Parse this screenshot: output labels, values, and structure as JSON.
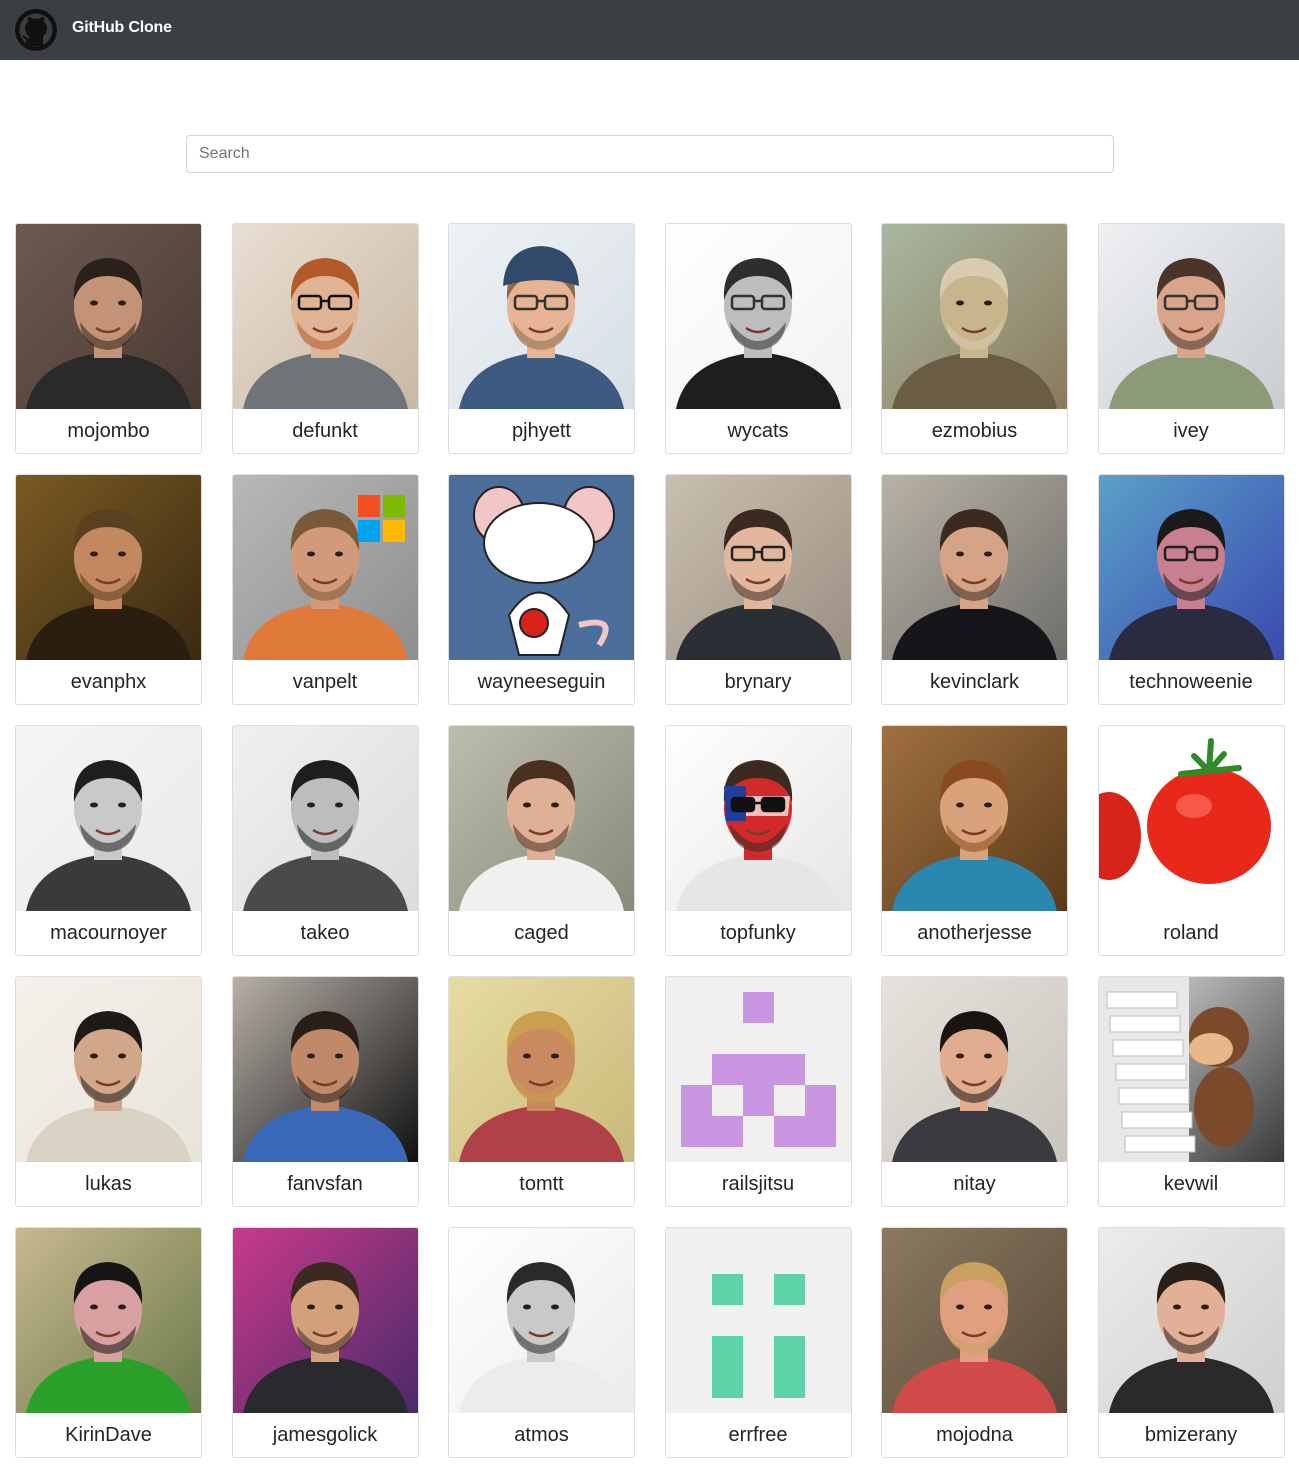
{
  "app": {
    "brand": "GitHub Clone",
    "logo_icon": "github-octocat-icon"
  },
  "search": {
    "placeholder": "Search",
    "value": ""
  },
  "users": [
    {
      "login": "mojombo",
      "bg": "#4a3a34",
      "skin": "#c49377",
      "hair": "#2b211c",
      "shirt": "#2a2a2a",
      "bgLight": "#6d5a50"
    },
    {
      "login": "defunkt",
      "bg": "#c9b8a4",
      "skin": "#e0b394",
      "hair": "#b35a2a",
      "shirt": "#6f7478",
      "bgLight": "#e8ded2",
      "glasses": "#111111"
    },
    {
      "login": "pjhyett",
      "bg": "#d7dfe5",
      "skin": "#e6b495",
      "hair": "#8a6a48",
      "shirt": "#3d5a80",
      "bgLight": "#eef2f5",
      "cap": "#2f4a6b",
      "glasses": "#333333"
    },
    {
      "login": "wycats",
      "bg": "#f2f2f2",
      "skin": "#bdbdbd",
      "hair": "#2e2e2e",
      "shirt": "#1e1e1e",
      "bgLight": "#ffffff",
      "glasses": "#333333"
    },
    {
      "login": "ezmobius",
      "bg": "#8a7a5e",
      "skin": "#c7b58c",
      "hair": "#d8cbb0",
      "shirt": "#6b5c45",
      "bgLight": "#a9b7a0"
    },
    {
      "login": "ivey",
      "bg": "#c9ccd1",
      "skin": "#d8a48a",
      "hair": "#4a3528",
      "shirt": "#8c9a7a",
      "bgLight": "#eef0f2",
      "glasses": "#333333"
    },
    {
      "login": "evanphx",
      "bg": "#3a2a12",
      "skin": "#c28860",
      "hair": "#5a4020",
      "shirt": "#2a1e10",
      "bgLight": "#7a5a22"
    },
    {
      "login": "vanpelt",
      "bg": "#8e8e8e",
      "skin": "#d29a78",
      "hair": "#7a5a38",
      "shirt": "#e07a3a",
      "bgLight": "#b8b8b8",
      "mslogo": true
    },
    {
      "login": "wayneeseguin",
      "bg": "#4c6e9a",
      "skin": "#ffffff",
      "hair": "#f2c6c6",
      "shirt": "#ffffff",
      "bgLight": "#4c6e9a",
      "cartoon": true
    },
    {
      "login": "brynary",
      "bg": "#9a8f82",
      "skin": "#e2b79e",
      "hair": "#3a2a20",
      "shirt": "#2a2e35",
      "bgLight": "#c9bfb0",
      "glasses": "#222222"
    },
    {
      "login": "kevinclark",
      "bg": "#6e6e6a",
      "skin": "#d5a386",
      "hair": "#3a2a20",
      "shirt": "#15151a",
      "bgLight": "#b9b2a6"
    },
    {
      "login": "technoweenie",
      "bg": "#3a4ab0",
      "skin": "#c87f8f",
      "hair": "#1a1a1a",
      "shirt": "#2a2a40",
      "bgLight": "#5aa0c8",
      "glasses": "#222222"
    },
    {
      "login": "macournoyer",
      "bg": "#eaeaea",
      "skin": "#c9c9c9",
      "hair": "#1f1f1f",
      "shirt": "#3a3a3a",
      "bgLight": "#f5f5f5"
    },
    {
      "login": "takeo",
      "bg": "#dcdcdc",
      "skin": "#bdbdbd",
      "hair": "#1e1e1e",
      "shirt": "#4a4a4a",
      "bgLight": "#f0f0f0"
    },
    {
      "login": "caged",
      "bg": "#8a8a7a",
      "skin": "#e0b096",
      "hair": "#4a3020",
      "shirt": "#f0f0f0",
      "bgLight": "#bdbdae"
    },
    {
      "login": "topfunky",
      "bg": "#e6e6e6",
      "skin": "#d22a2a",
      "hair": "#3a2a20",
      "shirt": "#e6e6e6",
      "bgLight": "#ffffff",
      "glasses": "#111111",
      "flag": true
    },
    {
      "login": "anotherjesse",
      "bg": "#5a3a1a",
      "skin": "#d9a27a",
      "hair": "#8a4a20",
      "shirt": "#2a88b0",
      "bgLight": "#a07040"
    },
    {
      "login": "roland",
      "bg": "#ffffff",
      "skin": "#e8281a",
      "hair": "#2f8a2a",
      "shirt": "#ffffff",
      "bgLight": "#ffffff",
      "tomato": true
    },
    {
      "login": "lukas",
      "bg": "#e8e4dc",
      "skin": "#d2a688",
      "hair": "#1e1a18",
      "shirt": "#d8d2c4",
      "bgLight": "#f4f1ea"
    },
    {
      "login": "fanvsfan",
      "bg": "#111111",
      "skin": "#c08a6a",
      "hair": "#2a1e18",
      "shirt": "#3a68b8",
      "bgLight": "#b8b0a8"
    },
    {
      "login": "tomtt",
      "bg": "#c9b97a",
      "skin": "#c98a60",
      "hair": "#c9a050",
      "shirt": "#b0404a",
      "bgLight": "#e8dca0"
    },
    {
      "login": "railsjitsu",
      "bg": "#f0f0f0",
      "identicon": "#c994e0",
      "identiconPattern": "ident1"
    },
    {
      "login": "nitay",
      "bg": "#c9c4bc",
      "skin": "#e2ac8e",
      "hair": "#1a1410",
      "shirt": "#3a3a40",
      "bgLight": "#e6e2dc"
    },
    {
      "login": "kevwil",
      "bg": "#3a3a3a",
      "skin": "#b8784a",
      "hair": "#7a4a2a",
      "shirt": "#d8d8d8",
      "bgLight": "#e0e0e0",
      "monkey": true
    },
    {
      "login": "KirinDave",
      "bg": "#6a7a4a",
      "skin": "#d8a0a0",
      "hair": "#151515",
      "shirt": "#2aa02a",
      "bgLight": "#c8b890"
    },
    {
      "login": "jamesgolick",
      "bg": "#4a2a6a",
      "skin": "#d2a07a",
      "hair": "#3a2a20",
      "shirt": "#2a2a2e",
      "bgLight": "#c83a8a"
    },
    {
      "login": "atmos",
      "bg": "#ececec",
      "skin": "#c9c9c9",
      "hair": "#2a2a2a",
      "shirt": "#ececec",
      "bgLight": "#ffffff"
    },
    {
      "login": "errfree",
      "bg": "#f0f0f0",
      "identicon": "#5ed3a7",
      "identiconPattern": "ident2"
    },
    {
      "login": "mojodna",
      "bg": "#5a4a3a",
      "skin": "#e0a080",
      "hair": "#c9a060",
      "shirt": "#d04a4a",
      "bgLight": "#8a7a60"
    },
    {
      "login": "bmizerany",
      "bg": "#cfcfcf",
      "skin": "#e2b096",
      "hair": "#2a201a",
      "shirt": "#2a2a2a",
      "bgLight": "#ececec"
    }
  ]
}
